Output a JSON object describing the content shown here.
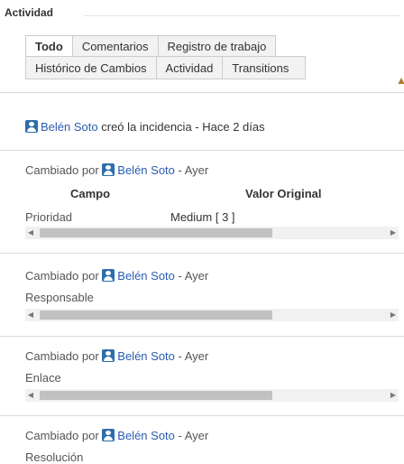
{
  "section": {
    "title": "Actividad"
  },
  "tabs": {
    "row1": [
      "Todo",
      "Comentarios",
      "Registro de trabajo"
    ],
    "row2": [
      "Histórico de Cambios",
      "Actividad",
      "Transitions"
    ],
    "active": "Todo"
  },
  "created": {
    "user": "Belén Soto",
    "text": "creó la incidencia - Hace 2 días"
  },
  "changes": [
    {
      "prefix": "Cambiado por",
      "user": "Belén Soto",
      "suffix": "- Ayer",
      "col_field": "Campo",
      "col_original": "Valor Original",
      "field": "Prioridad",
      "original": "Medium [ 3 ]"
    },
    {
      "prefix": "Cambiado por",
      "user": "Belén Soto",
      "suffix": "- Ayer",
      "field": "Responsable"
    },
    {
      "prefix": "Cambiado por",
      "user": "Belén Soto",
      "suffix": "- Ayer",
      "field": "Enlace"
    },
    {
      "prefix": "Cambiado por",
      "user": "Belén Soto",
      "suffix": "- Ayer",
      "field": "Resolución"
    }
  ],
  "icons": {
    "user": "user-icon",
    "collapse": "chevron-up-icon",
    "scroll_left": "arrow-left-icon",
    "scroll_right": "arrow-right-icon"
  },
  "colors": {
    "link": "#2a5db0",
    "user_icon": "#2f6dab"
  }
}
